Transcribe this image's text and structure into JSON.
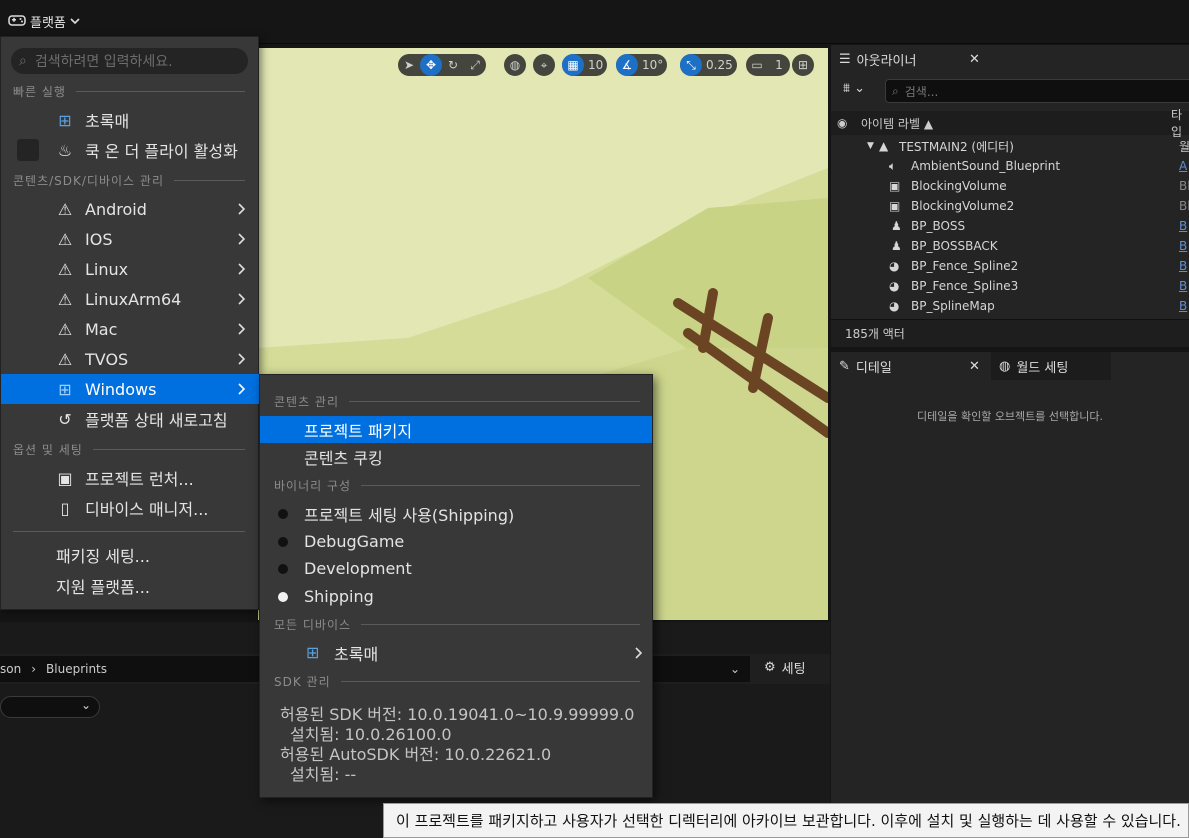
{
  "toolbar": {
    "platform_label": "플랫폼"
  },
  "viewport": {
    "grid_snap": "10",
    "rotation_snap": "10°",
    "scale_snap": "0.25",
    "camera_speed": "1"
  },
  "outliner": {
    "tab_label": "아웃라이너",
    "search_placeholder": "검색...",
    "col_label": "아이템 라벨 ▲",
    "col_type": "타입",
    "root": "TESTMAIN2 (에디터)",
    "root_type": "월",
    "rows": [
      {
        "label": "AmbientSound_Blueprint",
        "type": "A",
        "icon": "speaker-icon"
      },
      {
        "label": "BlockingVolume",
        "type": "Bl",
        "icon": "volume-icon"
      },
      {
        "label": "BlockingVolume2",
        "type": "Bl",
        "icon": "volume-icon"
      },
      {
        "label": "BP_BOSS",
        "type": "B",
        "icon": "pawn-icon"
      },
      {
        "label": "BP_BOSSBACK",
        "type": "B",
        "icon": "pawn-icon"
      },
      {
        "label": "BP_Fence_Spline2",
        "type": "B",
        "icon": "actor-sphere-icon"
      },
      {
        "label": "BP_Fence_Spline3",
        "type": "B",
        "icon": "actor-sphere-icon"
      },
      {
        "label": "BP_SplineMap",
        "type": "B",
        "icon": "actor-sphere-icon"
      }
    ],
    "footer": "185개 액터"
  },
  "details": {
    "tab_label": "디테일",
    "world_tab_label": "월드 세팅",
    "empty_message": "디테일을 확인할 오브젝트를 선택합니다."
  },
  "content_browser": {
    "path": [
      "son",
      "Blueprints"
    ],
    "settings_label": "세팅"
  },
  "platform_menu": {
    "search_placeholder": "검색하려면 입력하세요.",
    "sections": {
      "quick_launch": "빠른 실행",
      "content_sdk": "콘텐츠/SDK/디바이스 관리",
      "options": "옵션 및 세팅"
    },
    "quick_items": [
      "초록매",
      "쿡 온 더 플라이 활성화"
    ],
    "platforms": [
      "Android",
      "IOS",
      "Linux",
      "LinuxArm64",
      "Mac",
      "TVOS",
      "Windows"
    ],
    "refresh_label": "플랫폼 상태 새로고침",
    "option_items": [
      "프로젝트 런처...",
      "디바이스 매니저..."
    ],
    "bottom_items": [
      "패키징 세팅...",
      "지원 플랫폼..."
    ]
  },
  "windows_submenu": {
    "sections": {
      "content": "콘텐츠 관리",
      "binary": "바이너리 구성",
      "devices": "모든 디바이스",
      "sdk": "SDK 관리"
    },
    "content_items": [
      "프로젝트 패키지",
      "콘텐츠 쿠킹"
    ],
    "configs": [
      {
        "label": "프로젝트 세팅 사용(Shipping)",
        "selected": false
      },
      {
        "label": "DebugGame",
        "selected": false
      },
      {
        "label": "Development",
        "selected": false
      },
      {
        "label": "Shipping",
        "selected": true
      }
    ],
    "device": "초록매",
    "sdk_lines": [
      "허용된 SDK 버전: 10.0.19041.0~10.9.99999.0",
      "설치됨: 10.0.26100.0",
      "허용된 AutoSDK 버전: 10.0.22621.0",
      "설치됨: --"
    ]
  },
  "tooltip": "이 프로젝트를 패키지하고 사용자가 선택한 디렉터리에 아카이브 보관합니다. 이후에 설치 및 실행하는 데 사용할 수 있습니다.",
  "colors": {
    "accent": "#0070e0",
    "menu_bg": "#383838",
    "panel_bg": "#242424"
  }
}
